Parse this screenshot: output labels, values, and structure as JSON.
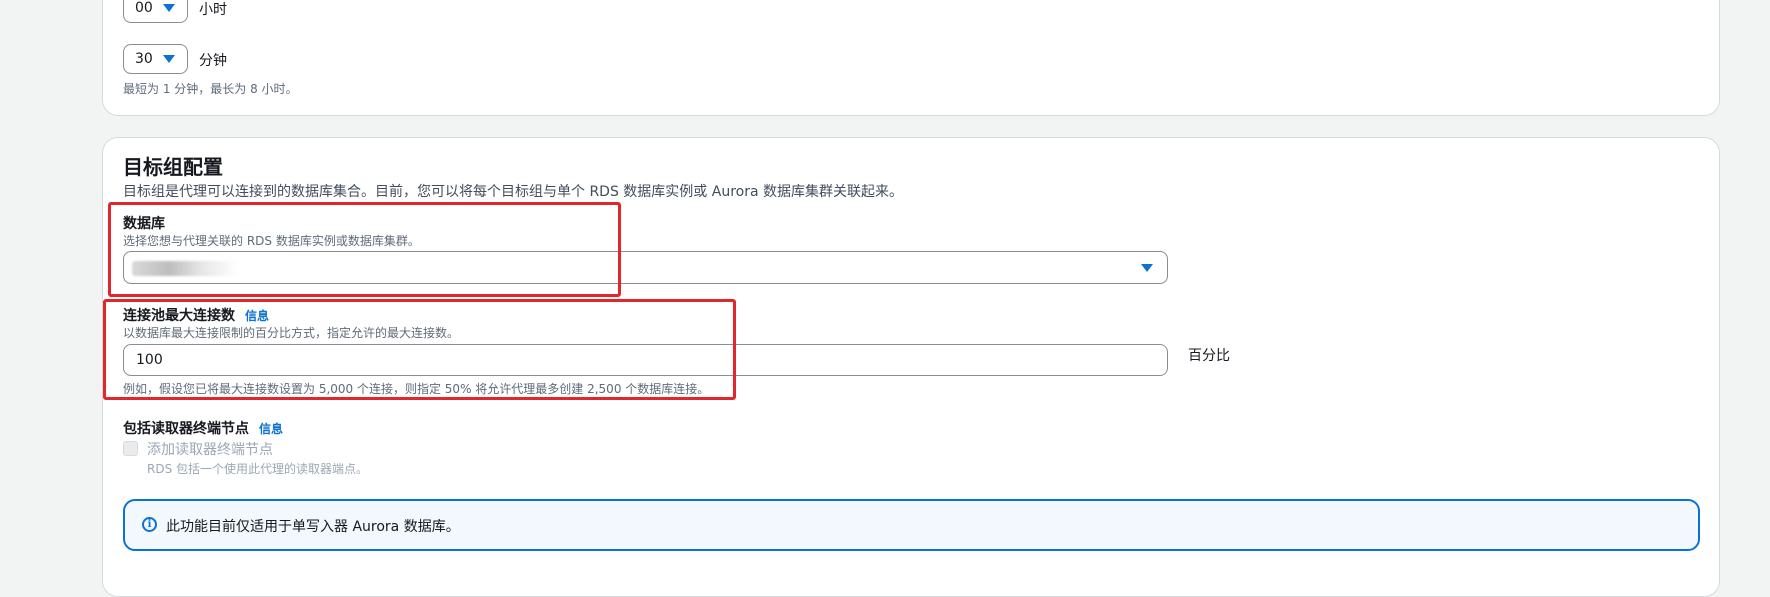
{
  "duration": {
    "hours": {
      "value": "00",
      "unit": "小时"
    },
    "minutes": {
      "value": "30",
      "unit": "分钟"
    },
    "hint": "最短为 1 分钟，最长为 8 小时。"
  },
  "target_group": {
    "title": "目标组配置",
    "description": "目标组是代理可以连接到的数据库集合。目前，您可以将每个目标组与单个 RDS 数据库实例或 Aurora 数据库集群关联起来。",
    "database": {
      "label": "数据库",
      "description": "选择您想与代理关联的 RDS 数据库实例或数据库集群。"
    },
    "max_connections": {
      "label": "连接池最大连接数",
      "info": "信息",
      "description": "以数据库最大连接限制的百分比方式，指定允许的最大连接数。",
      "value": "100",
      "unit": "百分比",
      "example": "例如，假设您已将最大连接数设置为 5,000 个连接，则指定 50% 将允许代理最多创建 2,500 个数据库连接。"
    },
    "reader_endpoint": {
      "label": "包括读取器终端节点",
      "info": "信息",
      "checkbox_label": "添加读取器终端节点",
      "checkbox_hint": "RDS 包括一个使用此代理的读取器端点。",
      "checked": false
    },
    "alert": {
      "text": "此功能目前仅适用于单写入器 Aurora 数据库。"
    }
  },
  "colors": {
    "accent": "#0972d3",
    "highlight": "#e3262b"
  }
}
